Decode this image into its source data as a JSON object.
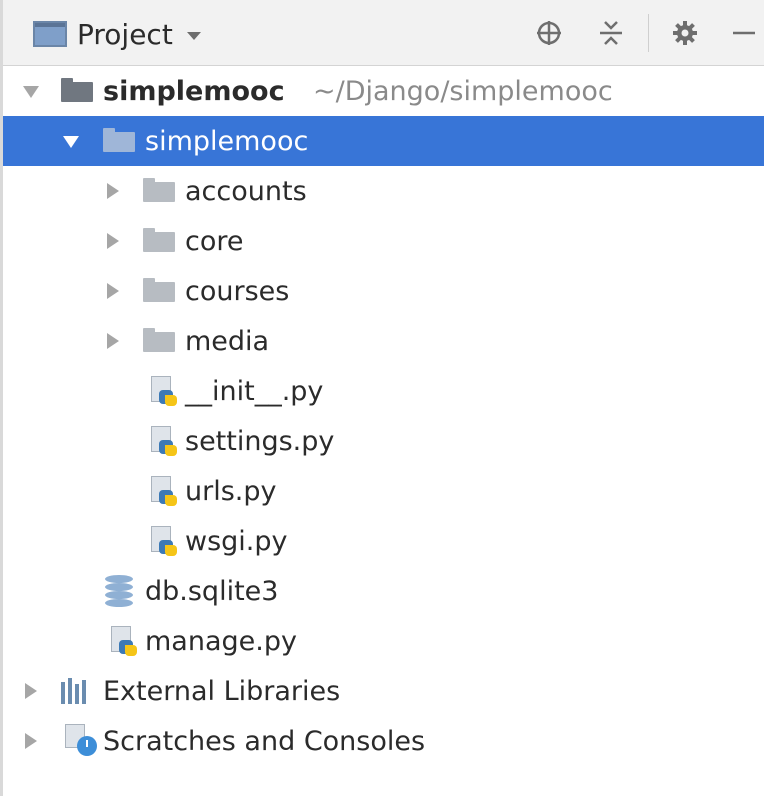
{
  "header": {
    "view_title": "Project",
    "view_icon": "project-view-icon",
    "tools": [
      "locate-icon",
      "collapse-all-icon",
      "gear-icon",
      "hide-icon"
    ],
    "locate_glyph": "⊕",
    "collapse_glyph": "≡",
    "gear_glyph": "⚙",
    "hide_glyph": "—"
  },
  "tree": {
    "root": {
      "label": "simplemooc",
      "path": "~/Django/simplemooc",
      "expanded": true
    },
    "package": {
      "label": "simplemooc",
      "expanded": true,
      "selected": true
    },
    "folders": [
      {
        "label": "accounts",
        "expanded": false
      },
      {
        "label": "core",
        "expanded": false
      },
      {
        "label": "courses",
        "expanded": false
      },
      {
        "label": "media",
        "expanded": false
      }
    ],
    "package_files": [
      "__init__.py",
      "settings.py",
      "urls.py",
      "wsgi.py"
    ],
    "root_files": [
      {
        "label": "db.sqlite3",
        "icon": "database-icon"
      },
      {
        "label": "manage.py",
        "icon": "python-file-icon"
      }
    ],
    "external_libraries": "External Libraries",
    "scratches": "Scratches and Consoles"
  },
  "colors": {
    "selection": "#3875d7",
    "header_bg": "#f2f2f2",
    "text": "#2b2b2b",
    "path_text": "#8a8a8a"
  }
}
